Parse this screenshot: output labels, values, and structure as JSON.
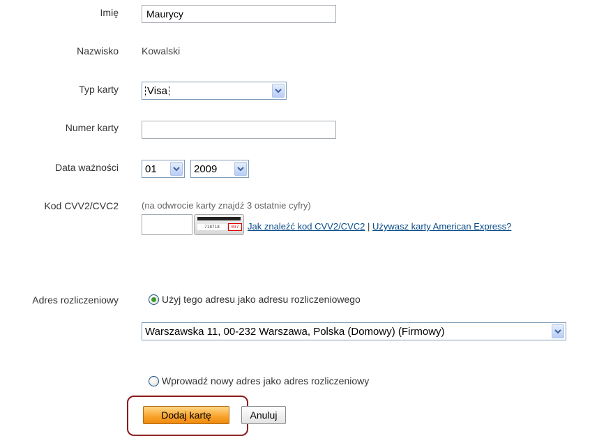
{
  "fields": {
    "first_name": {
      "label": "Imię",
      "value": "Maurycy"
    },
    "last_name": {
      "label": "Nazwisko",
      "value": "Kowalski"
    },
    "card_type": {
      "label": "Typ karty",
      "selected": "Visa"
    },
    "card_number": {
      "label": "Numer karty",
      "value": ""
    },
    "expiry": {
      "label": "Data ważności",
      "month": "01",
      "year": "2009"
    },
    "cvv": {
      "label": "Kod CVV2/CVC2",
      "hint": "(na odwrocie karty znajdź 3 ostatnie cyfry)",
      "value": "",
      "card_image": {
        "digits": "718718",
        "code": "037"
      },
      "help_link": "Jak znaleźć kod CVV2/CVC2",
      "separator": "|",
      "amex_link": "Używasz karty American Express?"
    }
  },
  "billing": {
    "label": "Adres rozliczeniowy",
    "use_existing_label": "Użyj tego adresu jako adresu rozliczeniowego",
    "use_existing_checked": true,
    "address_selected": "Warszawska 11, 00-232 Warszawa, Polska (Domowy) (Firmowy)",
    "new_address_label": "Wprowadź nowy adres jako adres rozliczeniowy",
    "new_address_checked": false
  },
  "actions": {
    "add_card_label": "Dodaj kartę",
    "cancel_label": "Anuluj"
  },
  "colors": {
    "primary_button": "#f8a22a",
    "link": "#084b8a",
    "highlight_border": "#8b1a1a"
  }
}
